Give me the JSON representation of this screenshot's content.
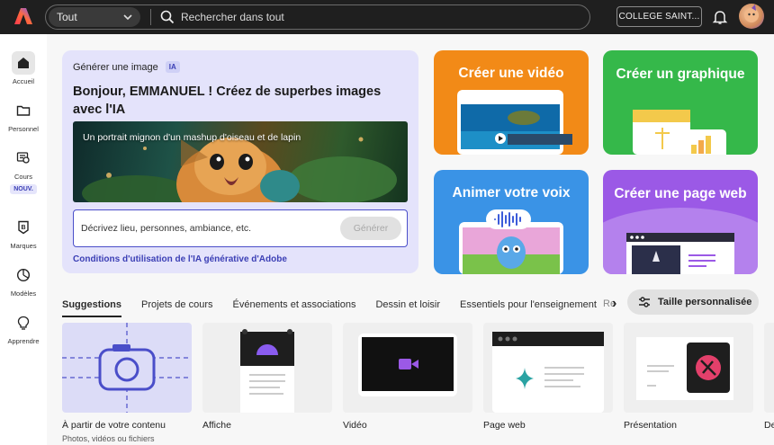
{
  "topbar": {
    "scope_label": "Tout",
    "search_placeholder": "Rechercher dans tout",
    "org_button": "COLLEGE SAINT..."
  },
  "sidebar": {
    "items": [
      {
        "label": "Accueil",
        "icon": "home-icon"
      },
      {
        "label": "Personnel",
        "icon": "folder-icon"
      },
      {
        "label": "Cours",
        "icon": "course-icon",
        "badge": "NOUV."
      },
      {
        "label": "Marques",
        "icon": "brand-icon"
      },
      {
        "label": "Modèles",
        "icon": "templates-icon"
      },
      {
        "label": "Apprendre",
        "icon": "lightbulb-icon"
      }
    ]
  },
  "hero": {
    "kicker": "Générer une image",
    "chip": "IA",
    "title": "Bonjour, EMMANUEL ! Créez de superbes images avec l'IA",
    "image_caption": "Un portrait mignon d'un mashup d'oiseau et de lapin",
    "prompt_placeholder": "Décrivez lieu, personnes, ambiance, etc.",
    "generate_button": "Générer",
    "terms_link": "Conditions d'utilisation de l'IA générative d'Adobe"
  },
  "quick_actions": [
    {
      "label": "Créer une vidéo",
      "color": "#f28a17"
    },
    {
      "label": "Créer un graphique",
      "color": "#35b84a"
    },
    {
      "label": "Animer votre voix",
      "color": "#3a93e6"
    },
    {
      "label": "Créer une page web",
      "color": "#9b59e6"
    }
  ],
  "tabs": {
    "items": [
      "Suggestions",
      "Projets de cours",
      "Événements et associations",
      "Dessin et loisir",
      "Essentiels pour l'enseignement"
    ],
    "overflow": "Re",
    "custom_size_button": "Taille personnalisée"
  },
  "tiles": [
    {
      "label": "À partir de votre contenu",
      "sub": "Photos, vidéos ou fichiers"
    },
    {
      "label": "Affiche"
    },
    {
      "label": "Vidéo"
    },
    {
      "label": "Page web"
    },
    {
      "label": "Présentation"
    },
    {
      "label": "De"
    }
  ]
}
